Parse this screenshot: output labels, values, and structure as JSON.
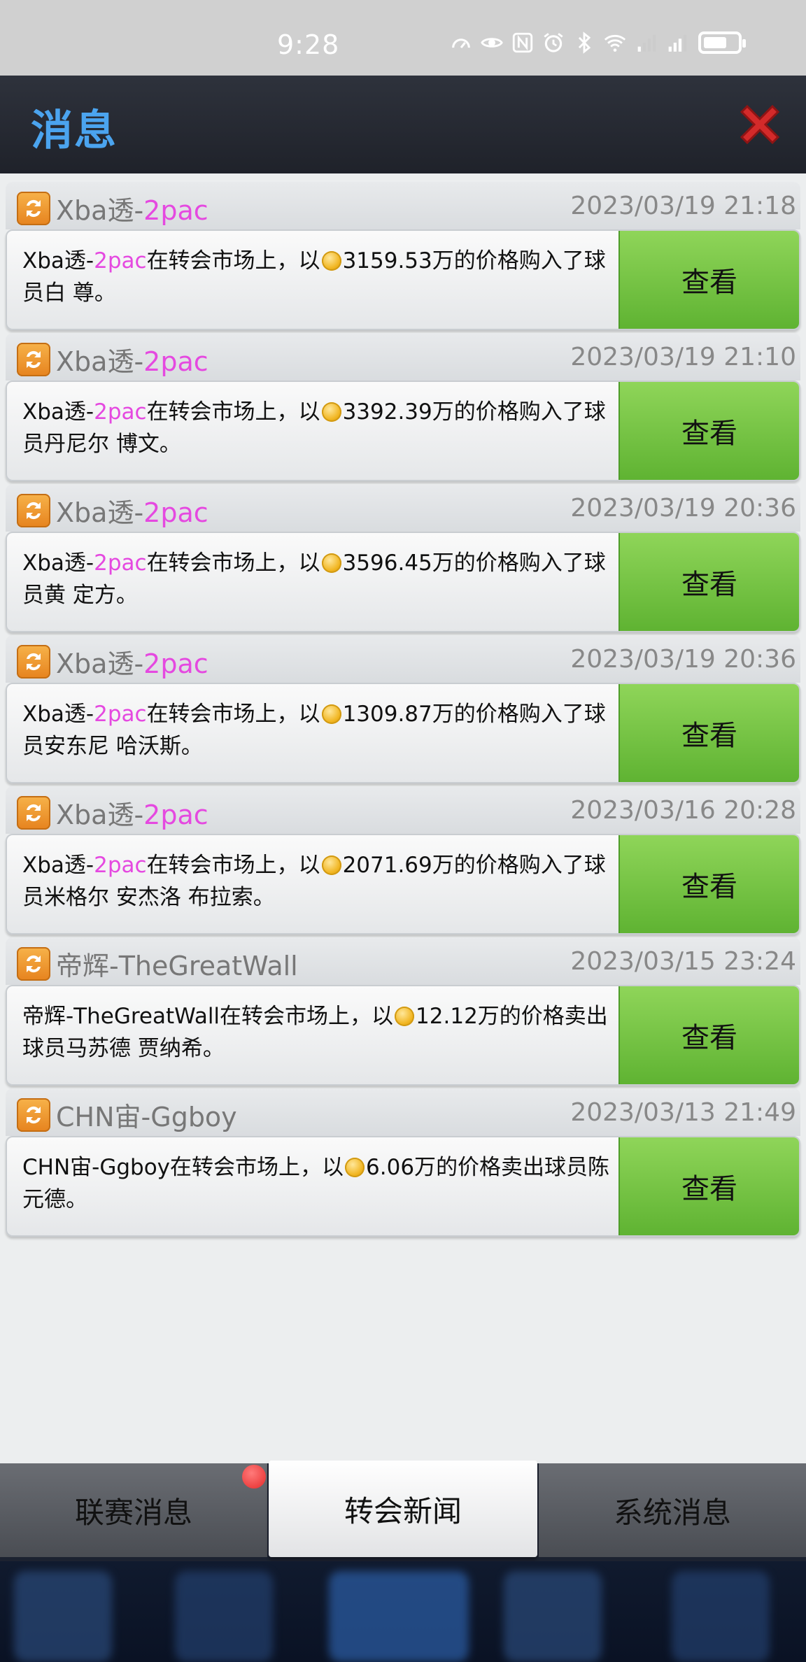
{
  "status_bar": {
    "time": "9:28"
  },
  "header": {
    "title": "消息"
  },
  "messages": [
    {
      "sender": "Xba透-",
      "sender_highlight": "2pac",
      "date": "2023/03/19 21:18",
      "body_pre": "Xba透-",
      "body_highlight": "2pac",
      "body_mid": "在转会市场上，以",
      "amount": "3159.53万",
      "body_post": "的价格购入了球员白 尊。"
    },
    {
      "sender": "Xba透-",
      "sender_highlight": "2pac",
      "date": "2023/03/19 21:10",
      "body_pre": "Xba透-",
      "body_highlight": "2pac",
      "body_mid": "在转会市场上，以",
      "amount": "3392.39万",
      "body_post": "的价格购入了球员丹尼尔 博文。"
    },
    {
      "sender": "Xba透-",
      "sender_highlight": "2pac",
      "date": "2023/03/19 20:36",
      "body_pre": "Xba透-",
      "body_highlight": "2pac",
      "body_mid": "在转会市场上，以",
      "amount": "3596.45万",
      "body_post": "的价格购入了球员黄 定方。"
    },
    {
      "sender": "Xba透-",
      "sender_highlight": "2pac",
      "date": "2023/03/19 20:36",
      "body_pre": "Xba透-",
      "body_highlight": "2pac",
      "body_mid": "在转会市场上，以",
      "amount": "1309.87万",
      "body_post": "的价格购入了球员安东尼 哈沃斯。"
    },
    {
      "sender": "Xba透-",
      "sender_highlight": "2pac",
      "date": "2023/03/16 20:28",
      "body_pre": "Xba透-",
      "body_highlight": "2pac",
      "body_mid": "在转会市场上，以",
      "amount": "2071.69万",
      "body_post": "的价格购入了球员米格尔 安杰洛 布拉索。"
    },
    {
      "sender": "帝辉-TheGreatWall",
      "sender_highlight": "",
      "date": "2023/03/15 23:24",
      "body_pre": "帝辉-TheGreatWall",
      "body_highlight": "",
      "body_mid": "在转会市场上，以",
      "amount": "12.12万",
      "body_post": "的价格卖出球员马苏德 贾纳希。"
    },
    {
      "sender": "CHN宙-Ggboy",
      "sender_highlight": "",
      "date": "2023/03/13 21:49",
      "body_pre": "CHN宙-Ggboy",
      "body_highlight": "",
      "body_mid": "在转会市场上，以",
      "amount": "6.06万",
      "body_post": "的价格卖出球员陈 元德。"
    }
  ],
  "view_label": "查看",
  "tabs": [
    {
      "label": "联赛消息",
      "active": false
    },
    {
      "label": "转会新闻",
      "active": true
    },
    {
      "label": "系统消息",
      "active": false
    }
  ],
  "colors": {
    "title_blue": "#4ba4ef",
    "highlight_pink": "#e549e0",
    "button_green": "#6cc23c",
    "badge_red": "#e52a2a"
  }
}
